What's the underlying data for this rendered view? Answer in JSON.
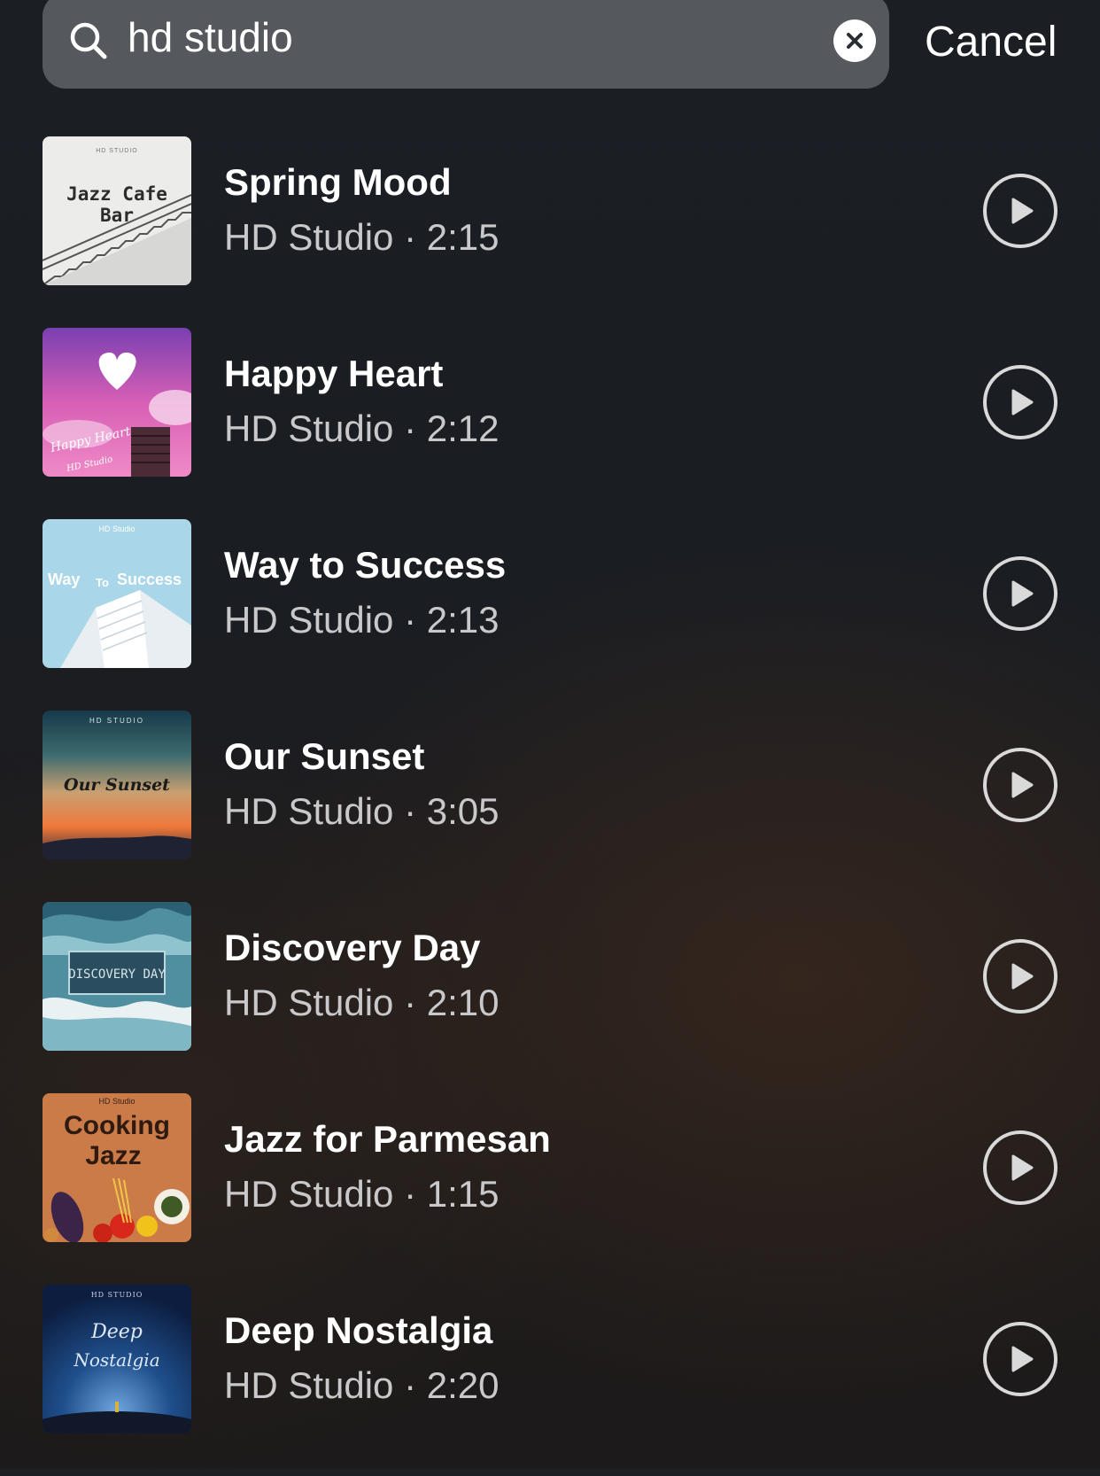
{
  "search": {
    "query": "hd studio",
    "icon": "search-icon",
    "clear_icon": "close-icon",
    "cancel_label": "Cancel"
  },
  "colors": {
    "background": "#1b1f24",
    "search_field": "#55595e",
    "text_primary": "#ffffff",
    "text_secondary": "#c9c9cb"
  },
  "results": [
    {
      "title": "Spring Mood",
      "artist": "HD Studio",
      "duration": "2:15",
      "meta": "HD Studio · 2:15",
      "cover": {
        "label": "HD STUDIO",
        "text_line1": "Jazz Cafe",
        "text_line2": "Bar"
      }
    },
    {
      "title": "Happy Heart",
      "artist": "HD Studio",
      "duration": "2:12",
      "meta": "HD Studio · 2:12",
      "cover": {
        "text_line1": "Happy Heart",
        "text_line2": "HD Studio"
      }
    },
    {
      "title": "Way to Success",
      "artist": "HD Studio",
      "duration": "2:13",
      "meta": "HD Studio · 2:13",
      "cover": {
        "label": "HD Studio",
        "text_line1": "Way",
        "text_line2": "To",
        "text_line3": "Success"
      }
    },
    {
      "title": "Our Sunset",
      "artist": "HD Studio",
      "duration": "3:05",
      "meta": "HD Studio · 3:05",
      "cover": {
        "label": "HD STUDIO",
        "text_line1": "Our Sunset"
      }
    },
    {
      "title": "Discovery Day",
      "artist": "HD Studio",
      "duration": "2:10",
      "meta": "HD Studio · 2:10",
      "cover": {
        "text_line1": "DISCOVERY DAY"
      }
    },
    {
      "title": "Jazz for Parmesan",
      "artist": "HD Studio",
      "duration": "1:15",
      "meta": "HD Studio · 1:15",
      "cover": {
        "label": "HD Studio",
        "text_line1": "Cooking",
        "text_line2": "Jazz"
      }
    },
    {
      "title": "Deep Nostalgia",
      "artist": "HD Studio",
      "duration": "2:20",
      "meta": "HD Studio · 2:20",
      "cover": {
        "label": "HD STUDIO",
        "text_line1": "Deep",
        "text_line2": "Nostalgia"
      }
    }
  ],
  "play_icon": "play-circle-icon"
}
